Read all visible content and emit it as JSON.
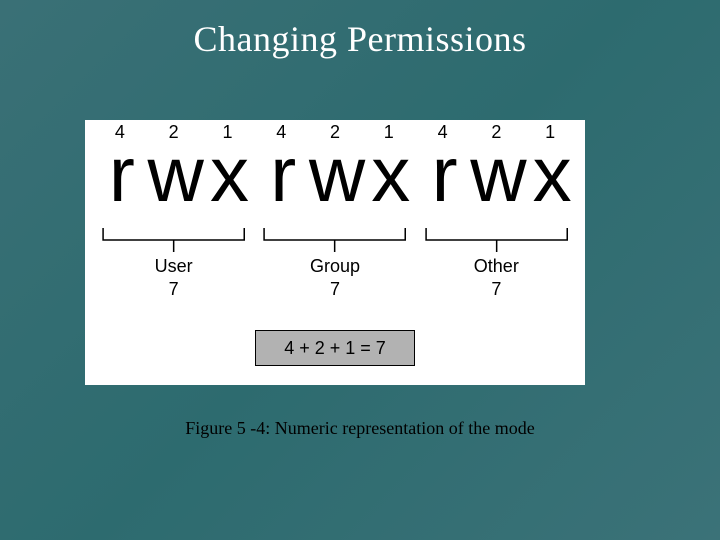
{
  "title": "Changing Permissions",
  "bits": [
    "4",
    "2",
    "1",
    "4",
    "2",
    "1",
    "4",
    "2",
    "1"
  ],
  "letters": [
    "r",
    "w",
    "x",
    "r",
    "w",
    "x",
    "r",
    "w",
    "x"
  ],
  "groups": [
    {
      "name": "User",
      "sum": "7"
    },
    {
      "name": "Group",
      "sum": "7"
    },
    {
      "name": "Other",
      "sum": "7"
    }
  ],
  "equation": "4 + 2 + 1 = 7",
  "caption": "Figure 5 -4: Numeric representation of the mode",
  "chart_data": {
    "type": "table",
    "title": "Numeric representation of the mode",
    "columns": [
      "bit_value",
      "permission_letter"
    ],
    "rows": [
      [
        4,
        "r"
      ],
      [
        2,
        "w"
      ],
      [
        1,
        "x"
      ],
      [
        4,
        "r"
      ],
      [
        2,
        "w"
      ],
      [
        1,
        "x"
      ],
      [
        4,
        "r"
      ],
      [
        2,
        "w"
      ],
      [
        1,
        "x"
      ]
    ],
    "groups": [
      {
        "name": "User",
        "sum": 7
      },
      {
        "name": "Group",
        "sum": 7
      },
      {
        "name": "Other",
        "sum": 7
      }
    ],
    "equation": "4 + 2 + 1 = 7"
  }
}
